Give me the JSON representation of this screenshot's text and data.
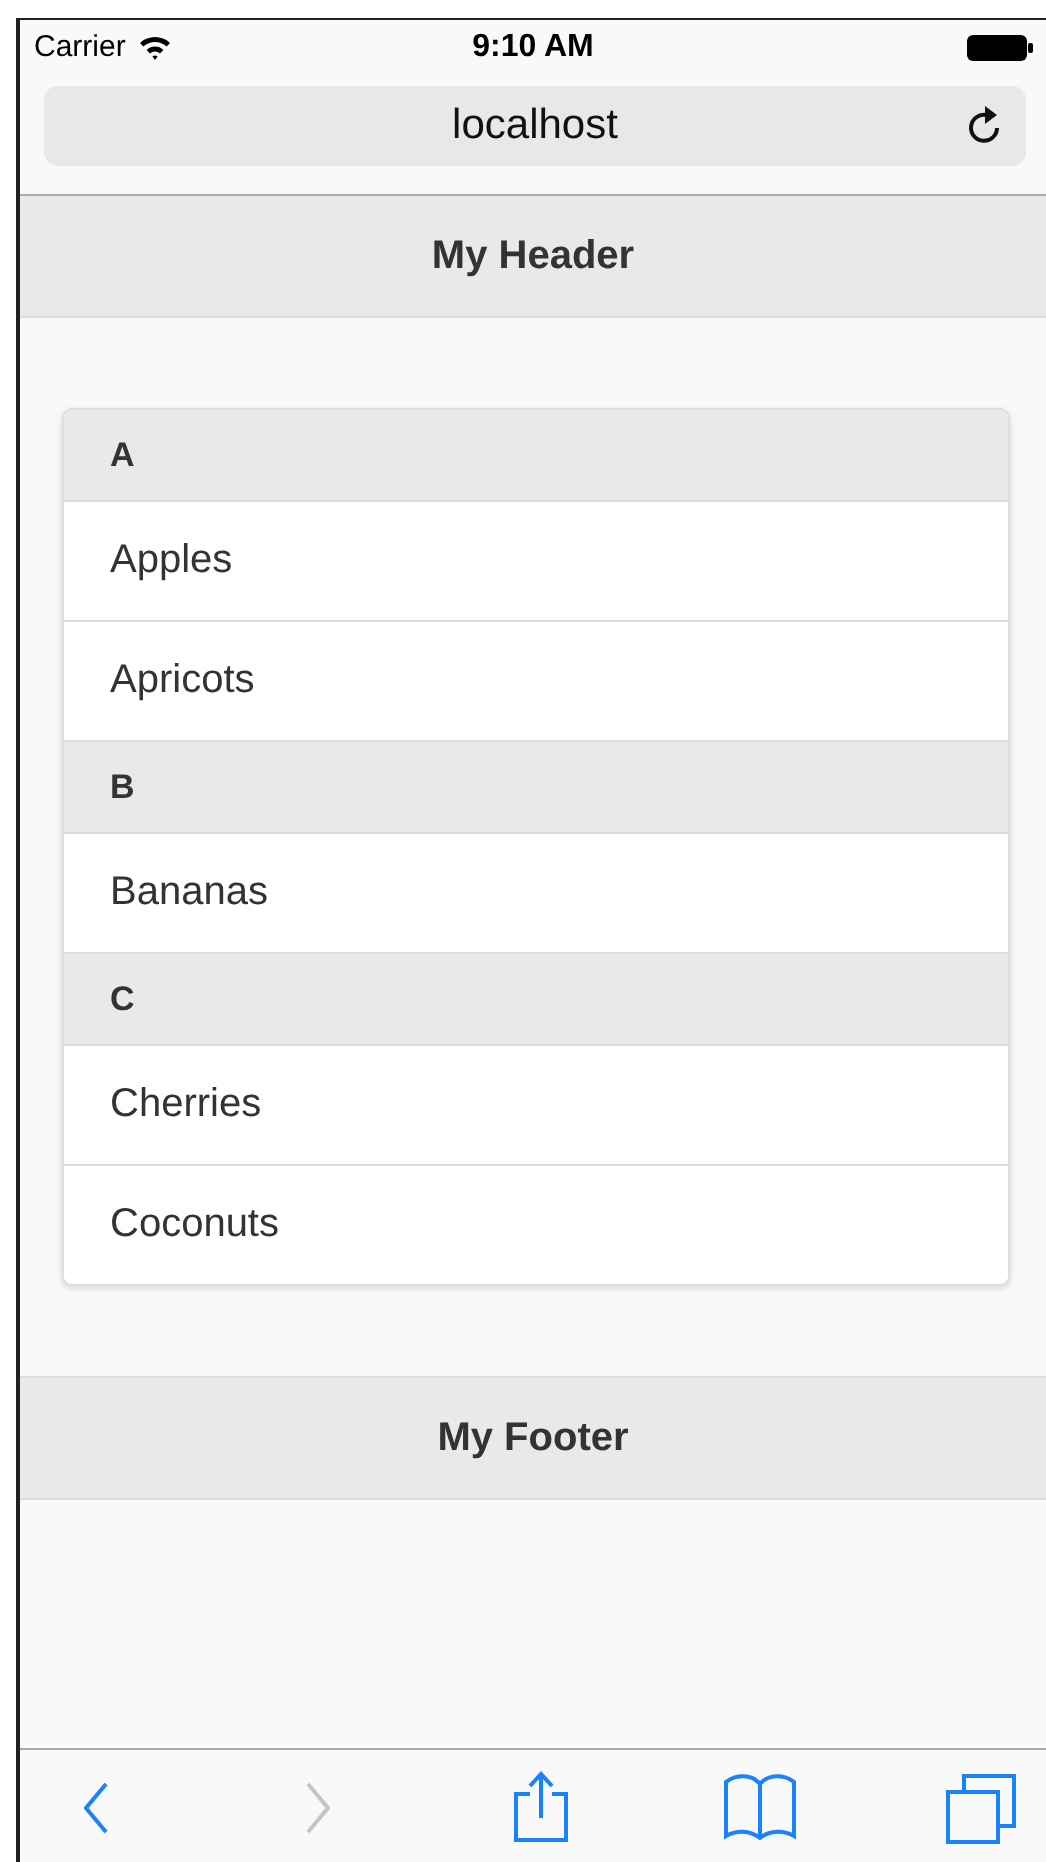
{
  "status_bar": {
    "carrier": "Carrier",
    "time": "9:10 AM"
  },
  "address_bar": {
    "url": "localhost"
  },
  "header": {
    "title": "My Header"
  },
  "list": [
    {
      "kind": "divider",
      "label": "A"
    },
    {
      "kind": "item",
      "label": "Apples"
    },
    {
      "kind": "item",
      "label": "Apricots"
    },
    {
      "kind": "divider",
      "label": "B"
    },
    {
      "kind": "item",
      "label": "Bananas"
    },
    {
      "kind": "divider",
      "label": "C"
    },
    {
      "kind": "item",
      "label": "Cherries"
    },
    {
      "kind": "item",
      "label": "Coconuts"
    }
  ],
  "footer": {
    "title": "My Footer"
  },
  "toolbar": [
    {
      "kind": "back",
      "disabled": false
    },
    {
      "kind": "forward",
      "disabled": true
    },
    {
      "kind": "share",
      "disabled": false
    },
    {
      "kind": "bookmarks",
      "disabled": false
    },
    {
      "kind": "tabs",
      "disabled": false
    }
  ]
}
